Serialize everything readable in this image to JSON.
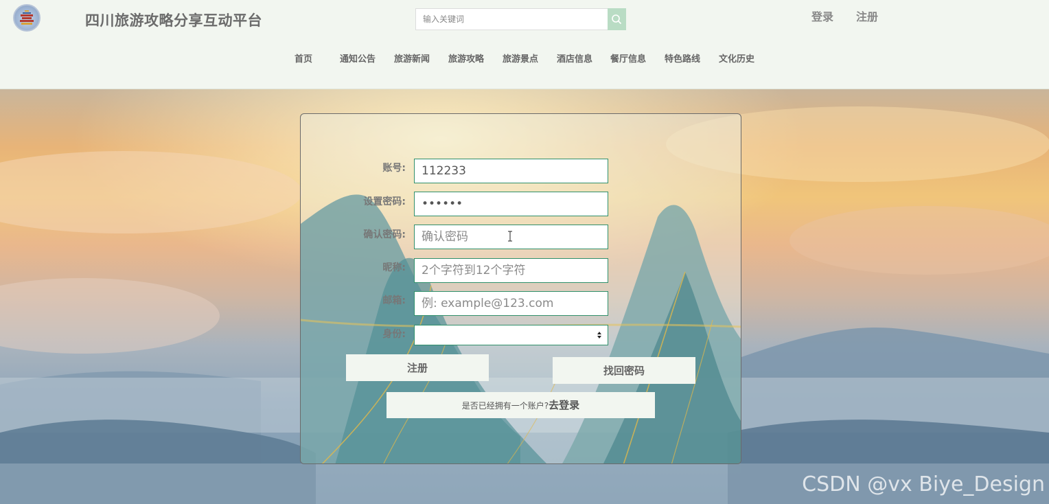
{
  "header": {
    "site_title": "四川旅游攻略分享互动平台",
    "search_placeholder": "输入关键词",
    "login_label": "登录",
    "register_label": "注册",
    "logo_icon": "temple-icon",
    "search_icon": "search-icon"
  },
  "nav": {
    "items": [
      {
        "label": "首页"
      },
      {
        "label": "通知公告"
      },
      {
        "label": "旅游新闻"
      },
      {
        "label": "旅游攻略"
      },
      {
        "label": "旅游景点"
      },
      {
        "label": "酒店信息"
      },
      {
        "label": "餐厅信息"
      },
      {
        "label": "特色路线"
      },
      {
        "label": "文化历史"
      }
    ]
  },
  "form": {
    "account": {
      "label": "账号:",
      "value": "112233",
      "placeholder": ""
    },
    "password": {
      "label": "设置密码:",
      "value": "••••••",
      "placeholder": ""
    },
    "confirm": {
      "label": "确认密码:",
      "value": "",
      "placeholder": "确认密码"
    },
    "nickname": {
      "label": "昵称:",
      "value": "",
      "placeholder": "2个字符到12个字符"
    },
    "email": {
      "label": "邮箱:",
      "value": "",
      "placeholder": "例: example@123.com"
    },
    "identity": {
      "label": "身份:",
      "value": ""
    },
    "register_button": "注册",
    "recover_button": "找回密码",
    "login_prompt": "是否已经拥有一个账户?",
    "login_link": "去登录"
  },
  "watermark": "CSDN @vx Biye_Design",
  "colors": {
    "header_bg": "#f2f6f0",
    "field_border": "#2f8f6a",
    "search_button": "#b9dcc4"
  }
}
